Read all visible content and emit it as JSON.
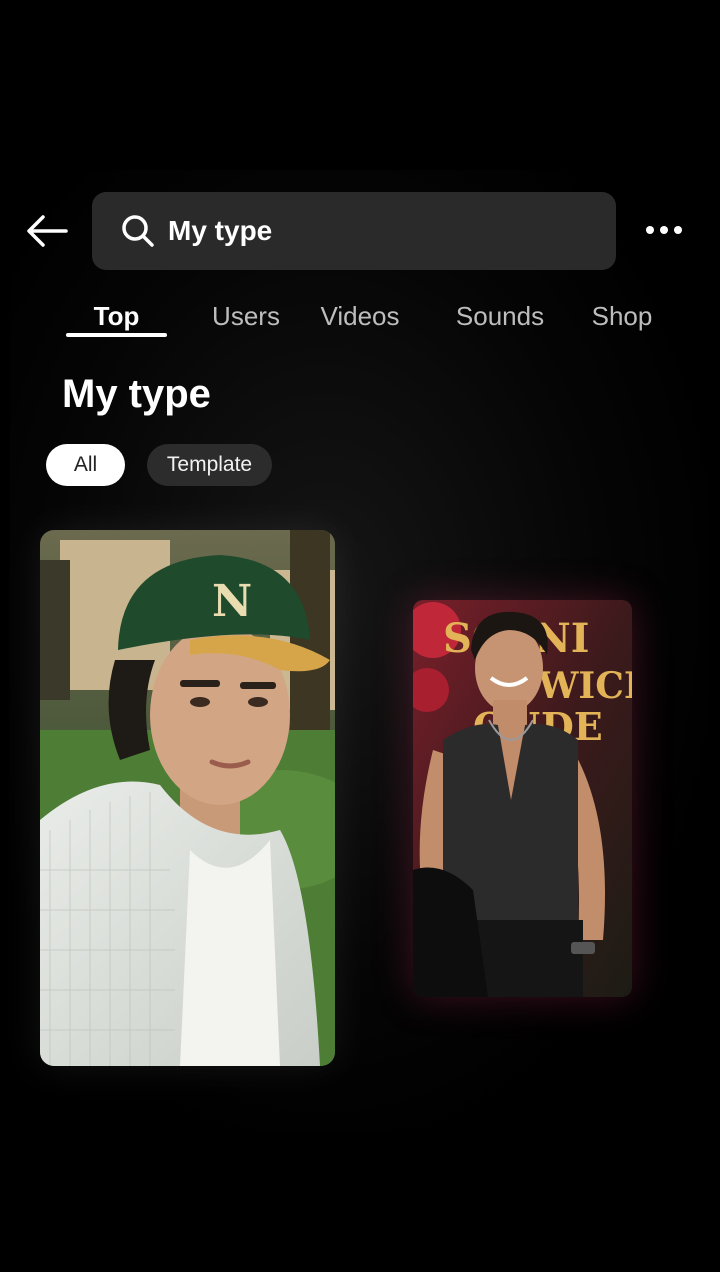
{
  "header": {
    "back_icon": "arrow-left-icon",
    "search": {
      "icon": "search-icon",
      "query": "My type"
    },
    "more_icon": "more-horizontal-icon"
  },
  "tabs": [
    {
      "label": "Top",
      "active": true
    },
    {
      "label": "Users",
      "active": false
    },
    {
      "label": "Videos",
      "active": false
    },
    {
      "label": "Sounds",
      "active": false
    },
    {
      "label": "Shop",
      "active": false
    }
  ],
  "section": {
    "title": "My type"
  },
  "filters": [
    {
      "label": "All",
      "selected": true
    },
    {
      "label": "Template",
      "selected": false
    }
  ],
  "results": [
    {
      "type": "photo",
      "subject": "young man in green baseball cap outdoors"
    },
    {
      "type": "photo",
      "subject": "man in black vest at red carpet event"
    }
  ],
  "colors": {
    "background": "#000000",
    "search_bg": "#2a2a2a",
    "chip_selected_bg": "#ffffff",
    "chip_bg": "#2c2c2c",
    "tab_inactive": "#bdbdbd"
  }
}
